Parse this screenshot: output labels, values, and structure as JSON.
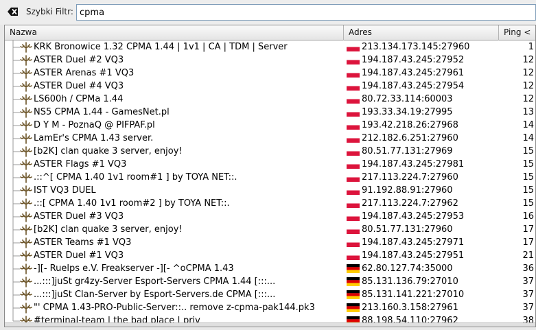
{
  "filter": {
    "label": "Szybki Filtr:",
    "value": "cpma"
  },
  "columns": {
    "name": "Nazwa",
    "address": "Adres",
    "ping": "Ping <"
  },
  "colors": {
    "flag_pl_white": "#ffffff",
    "flag_pl_red": "#dc143c",
    "flag_de_black": "#000000",
    "flag_de_red": "#dd0000",
    "flag_de_gold": "#ffce00",
    "icon_color": "#6b5326"
  },
  "servers": [
    {
      "name": "KRK Bronowice 1.32 CPMA 1.44  | 1v1 | CA | TDM |  Server",
      "address": "213.134.173.145:27960",
      "ping": "1",
      "flag": "pl"
    },
    {
      "name": "ASTER Duel #2 VQ3",
      "address": "194.187.43.245:27952",
      "ping": "12",
      "flag": "pl"
    },
    {
      "name": "ASTER Arenas #1 VQ3",
      "address": "194.187.43.245:27961",
      "ping": "12",
      "flag": "pl"
    },
    {
      "name": "ASTER Duel #4 VQ3",
      "address": "194.187.43.245:27954",
      "ping": "12",
      "flag": "pl"
    },
    {
      "name": "LS600h / CPMa 1.44",
      "address": "80.72.33.114:60003",
      "ping": "12",
      "flag": "pl"
    },
    {
      "name": "NS5 CPMA 1.44 - GamesNet.pl",
      "address": "193.33.34.19:27995",
      "ping": "13",
      "flag": "pl"
    },
    {
      "name": "D Y M - PoznaQ @ PIFPAF.pl",
      "address": "193.42.218.26:27968",
      "ping": "14",
      "flag": "pl"
    },
    {
      "name": "LamEr's CPMA 1.43 server.",
      "address": "212.182.6.251:27960",
      "ping": "14",
      "flag": "pl"
    },
    {
      "name": "[b2K] clan quake 3 server, enjoy!",
      "address": "80.51.77.131:27969",
      "ping": "15",
      "flag": "pl"
    },
    {
      "name": "ASTER Flags #1 VQ3",
      "address": "194.187.43.245:27981",
      "ping": "15",
      "flag": "pl"
    },
    {
      "name": ".::^[ CPMA 1.40 1v1 room#1 ] by TOYA NET::.",
      "address": "217.113.224.7:27960",
      "ping": "15",
      "flag": "pl"
    },
    {
      "name": "IST VQ3 DUEL",
      "address": "91.192.88.91:27960",
      "ping": "15",
      "flag": "pl"
    },
    {
      "name": ".::[ CPMA 1.40 1v1 room#2 ] by TOYA NET::.",
      "address": "217.113.224.7:27962",
      "ping": "15",
      "flag": "pl"
    },
    {
      "name": "ASTER Duel #3 VQ3",
      "address": "194.187.43.245:27953",
      "ping": "16",
      "flag": "pl"
    },
    {
      "name": "[b2K] clan quake 3 server, enjoy!",
      "address": "80.51.77.131:27960",
      "ping": "17",
      "flag": "pl"
    },
    {
      "name": "ASTER Teams #1 VQ3",
      "address": "194.187.43.245:27971",
      "ping": "17",
      "flag": "pl"
    },
    {
      "name": "ASTER Duel #1 VQ3",
      "address": "194.187.43.245:27951",
      "ping": "21",
      "flag": "pl"
    },
    {
      "name": "-][- Ruelps e.V. Freakserver -][- ^oCPMA 1.43",
      "address": "62.80.127.74:35000",
      "ping": "36",
      "flag": "de"
    },
    {
      "name": "...:::]juSt gr4zy-Server Esport-Servers CPMA 1.44 [:::...",
      "address": "85.131.136.79:27010",
      "ping": "37",
      "flag": "de"
    },
    {
      "name": "...:::]juSt Clan-Server by Esport-Servers.de CPMA [:::...",
      "address": "85.131.141.221:27010",
      "ping": "37",
      "flag": "de"
    },
    {
      "name": "\"' CPMA 1.43-PRO-Public-Server::.. remove z-cpma-pak144.pk3",
      "address": "213.160.3.158:27961",
      "ping": "37",
      "flag": "de"
    },
    {
      "name": "#terminal-team | the bad place | priv",
      "address": "88.198.54.110:27962",
      "ping": "38",
      "flag": "de"
    }
  ]
}
